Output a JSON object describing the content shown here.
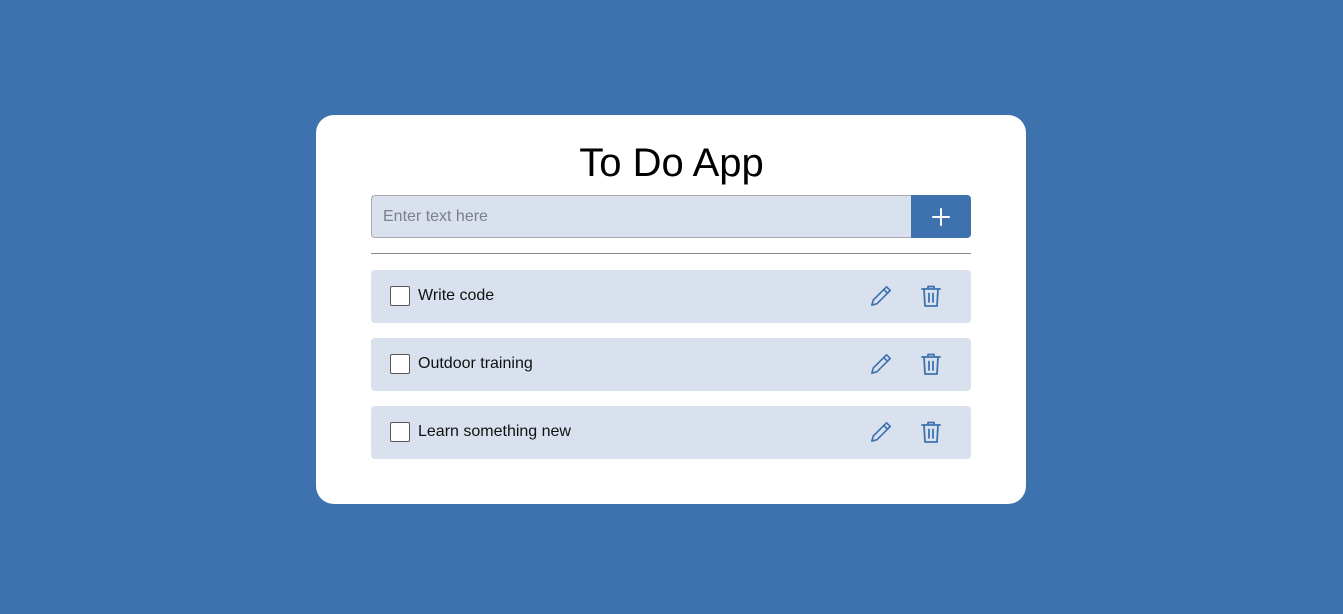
{
  "app": {
    "title": "To Do App"
  },
  "input": {
    "value": "",
    "placeholder": "Enter text here"
  },
  "add_button": {
    "icon": "plus-icon"
  },
  "todos": [
    {
      "label": "Write code",
      "checked": false
    },
    {
      "label": "Outdoor training",
      "checked": false
    },
    {
      "label": "Learn something new",
      "checked": false
    }
  ],
  "item_actions": {
    "edit_icon": "pencil-icon",
    "delete_icon": "trash-icon"
  },
  "colors": {
    "background": "#3e72af",
    "card": "#ffffff",
    "item_background": "#d9e0ee",
    "accent": "#3e72af"
  }
}
